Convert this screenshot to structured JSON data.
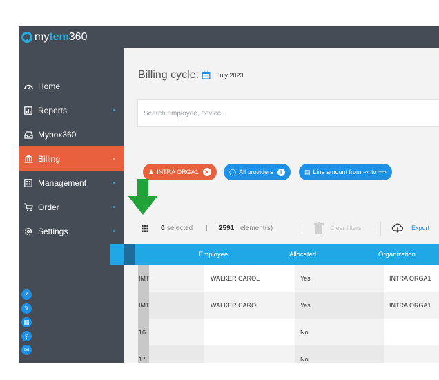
{
  "brand": {
    "part1": "my",
    "part2": "tem",
    "part3": "360"
  },
  "sidebar": {
    "items": [
      {
        "label": "Home",
        "icon": "dashboard-icon",
        "has_dot": false
      },
      {
        "label": "Reports",
        "icon": "report-icon",
        "has_dot": true
      },
      {
        "label": "Mybox360",
        "icon": "inbox-icon",
        "has_dot": false
      },
      {
        "label": "Billing",
        "icon": "bank-icon",
        "has_dot": true,
        "active": true
      },
      {
        "label": "Management",
        "icon": "building-icon",
        "has_dot": true
      },
      {
        "label": "Order",
        "icon": "cart-icon",
        "has_dot": true
      },
      {
        "label": "Settings",
        "icon": "gear-icon",
        "has_dot": true
      }
    ],
    "bottom_icons": [
      "collapse-icon",
      "pencil-icon",
      "calculator-icon",
      "help-icon",
      "mail-icon"
    ]
  },
  "billing": {
    "label": "Billing cycle:",
    "value": "July 2023"
  },
  "search": {
    "placeholder": "Search employee, device..."
  },
  "filters": [
    {
      "label": "INTRA ORGA1",
      "color": "#e8603c",
      "icon": "org-icon",
      "action": "remove"
    },
    {
      "label": "All providers",
      "color": "#1e90e6",
      "icon": "provider-icon",
      "action": "info"
    },
    {
      "label": "Line amount from -∞ to +∞",
      "color": "#1e90e6",
      "icon": "chart-icon",
      "action": "none"
    }
  ],
  "toolbar": {
    "selected_count": "0",
    "selected_label": "selected",
    "separator": "|",
    "element_count": "2591",
    "element_label": "element(s)",
    "clear_filters": "Clear filters",
    "export": "Export"
  },
  "table": {
    "columns": [
      "Employee",
      "Allocated",
      "Organization"
    ],
    "rows": [
      {
        "stub": "IMT",
        "employee": "WALKER CAROL",
        "allocated": "Yes",
        "organization": "INTRA ORGA1"
      },
      {
        "stub": "IMT",
        "employee": "WALKER CAROL",
        "allocated": "Yes",
        "organization": "INTRA ORGA1"
      },
      {
        "stub": "16",
        "employee": "",
        "allocated": "No",
        "organization": ""
      },
      {
        "stub": "17",
        "employee": "",
        "allocated": "No",
        "organization": ""
      }
    ]
  },
  "colors": {
    "sidebar": "#454c55",
    "accent": "#e8603c",
    "brand_blue": "#29a9e0",
    "header_blue": "#1fa8e5",
    "arrow": "#22a33a"
  }
}
